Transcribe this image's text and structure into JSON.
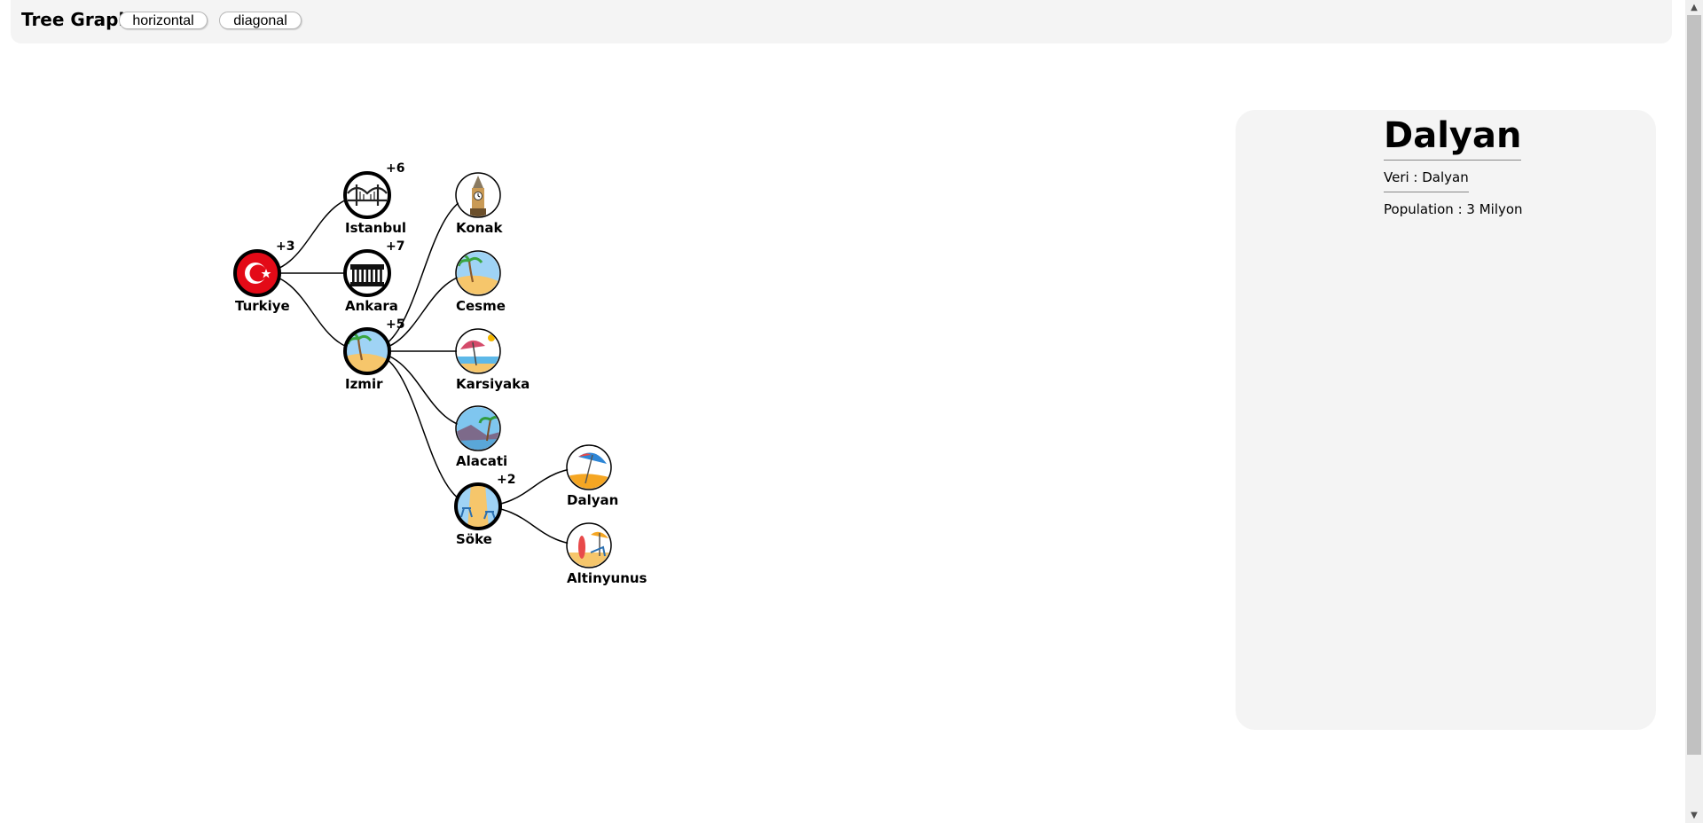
{
  "header": {
    "title": "Tree Graph",
    "buttons": [
      "horizontal",
      "diagonal"
    ]
  },
  "tree": {
    "nodes": [
      {
        "id": "turkiye",
        "label": "Turkiye",
        "count": "+3",
        "icon": "turkey-flag-icon",
        "bold": true
      },
      {
        "id": "istanbul",
        "label": "Istanbul",
        "count": "+6",
        "icon": "bridge-icon",
        "bold": true
      },
      {
        "id": "ankara",
        "label": "Ankara",
        "count": "+7",
        "icon": "mausoleum-icon",
        "bold": true
      },
      {
        "id": "izmir",
        "label": "Izmir",
        "count": "+5",
        "icon": "beach-palm-icon",
        "bold": true
      },
      {
        "id": "konak",
        "label": "Konak",
        "count": "",
        "icon": "clock-tower-icon",
        "bold": false
      },
      {
        "id": "cesme",
        "label": "Cesme",
        "count": "",
        "icon": "beach-palm-icon",
        "bold": false
      },
      {
        "id": "karsiyaka",
        "label": "Karsiyaka",
        "count": "",
        "icon": "beach-umbrella-icon",
        "bold": false
      },
      {
        "id": "alacati",
        "label": "Alacati",
        "count": "",
        "icon": "island-palm-icon",
        "bold": false
      },
      {
        "id": "soke",
        "label": "Söke",
        "count": "+2",
        "icon": "beach-chairs-icon",
        "bold": true
      },
      {
        "id": "dalyan",
        "label": "Dalyan",
        "count": "",
        "icon": "parasol-icon",
        "bold": false
      },
      {
        "id": "altinyunus",
        "label": "Altinyunus",
        "count": "",
        "icon": "surfboard-beach-icon",
        "bold": false
      }
    ],
    "edges": [
      [
        "turkiye",
        "istanbul"
      ],
      [
        "turkiye",
        "ankara"
      ],
      [
        "turkiye",
        "izmir"
      ],
      [
        "izmir",
        "konak"
      ],
      [
        "izmir",
        "cesme"
      ],
      [
        "izmir",
        "karsiyaka"
      ],
      [
        "izmir",
        "alacati"
      ],
      [
        "izmir",
        "soke"
      ],
      [
        "soke",
        "dalyan"
      ],
      [
        "soke",
        "altinyunus"
      ]
    ]
  },
  "detail": {
    "title": "Dalyan",
    "veri": "Veri : Dalyan",
    "population": "Population : 3 Milyon"
  },
  "colors": {
    "flag_red": "#e30a17",
    "sky_blue": "#9fd3f5",
    "sand": "#f6c66b",
    "panel_bg": "#f4f4f4"
  }
}
